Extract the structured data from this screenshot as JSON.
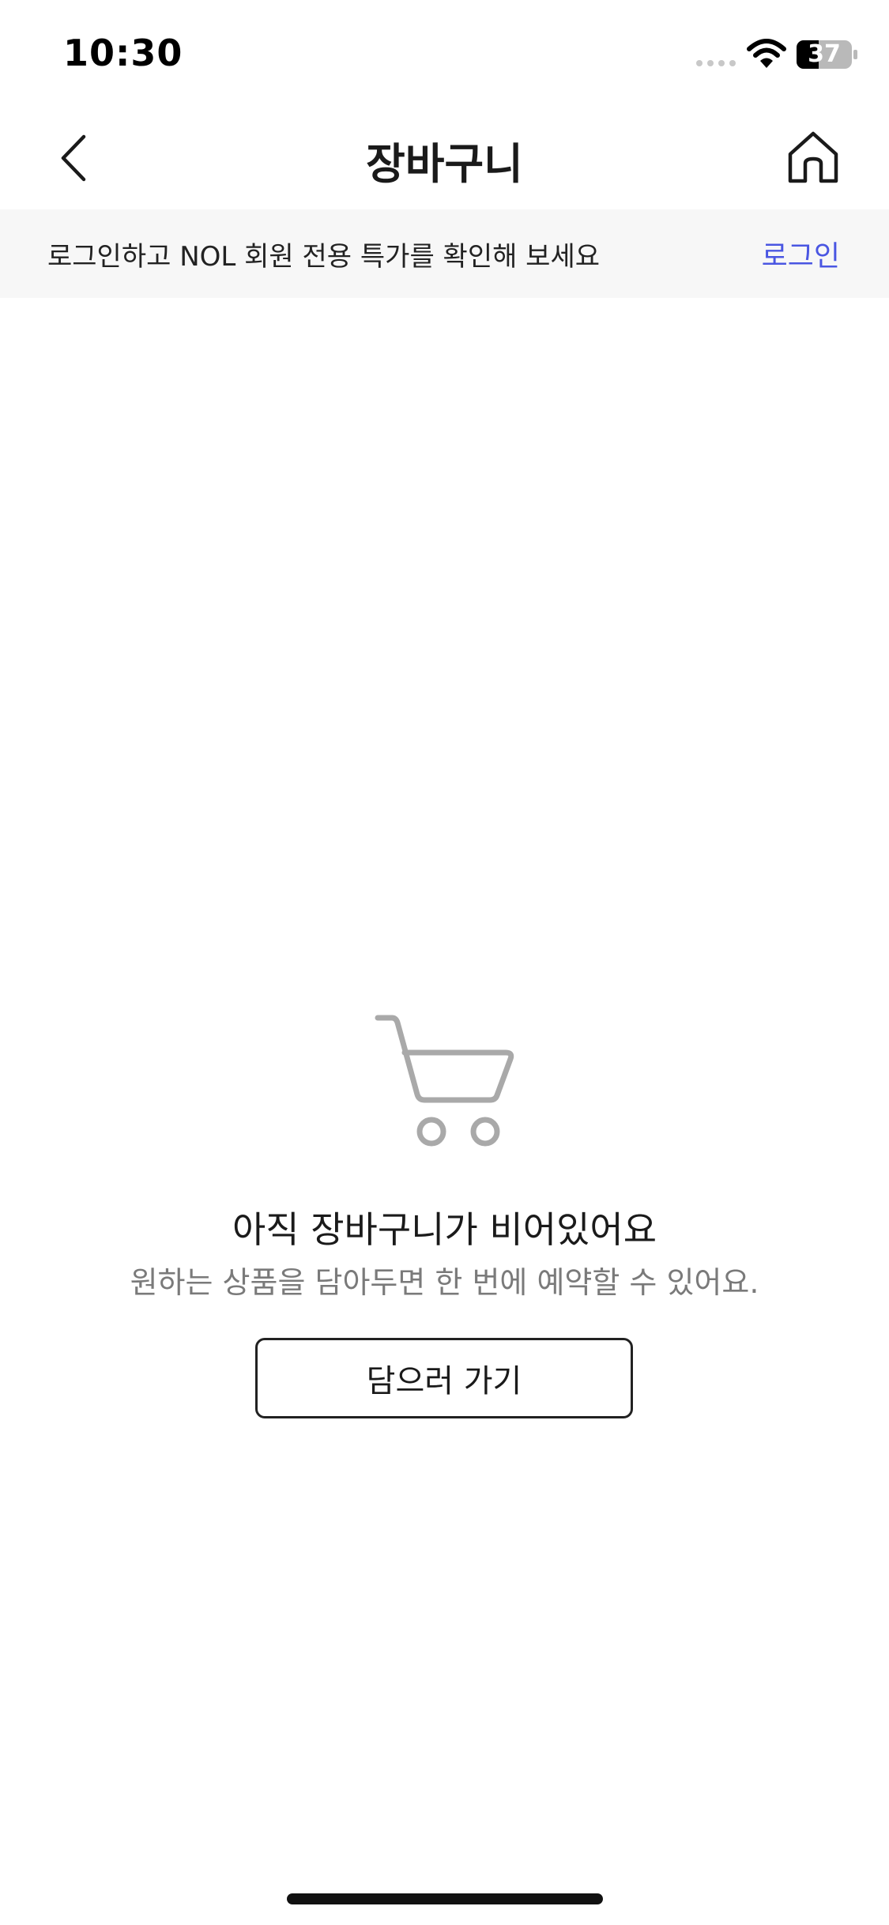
{
  "status_bar": {
    "time": "10:30",
    "battery": "37"
  },
  "header": {
    "title": "장바구니",
    "back_icon": "chevron-left-icon",
    "home_icon": "home-icon"
  },
  "banner": {
    "text": "로그인하고 NOL 회원 전용 특가를 확인해 보세요",
    "login_label": "로그인"
  },
  "empty_state": {
    "icon": "cart-icon",
    "title": "아직 장바구니가 비어있어요",
    "subtitle": "원하는 상품을 담아두면 한 번에 예약할 수 있어요.",
    "button_label": "담으러 가기"
  },
  "colors": {
    "accent": "#4a56e2",
    "banner_bg": "#f7f7f7",
    "icon_gray": "#a9a9a9",
    "subtitle_gray": "#7a7a7a"
  }
}
